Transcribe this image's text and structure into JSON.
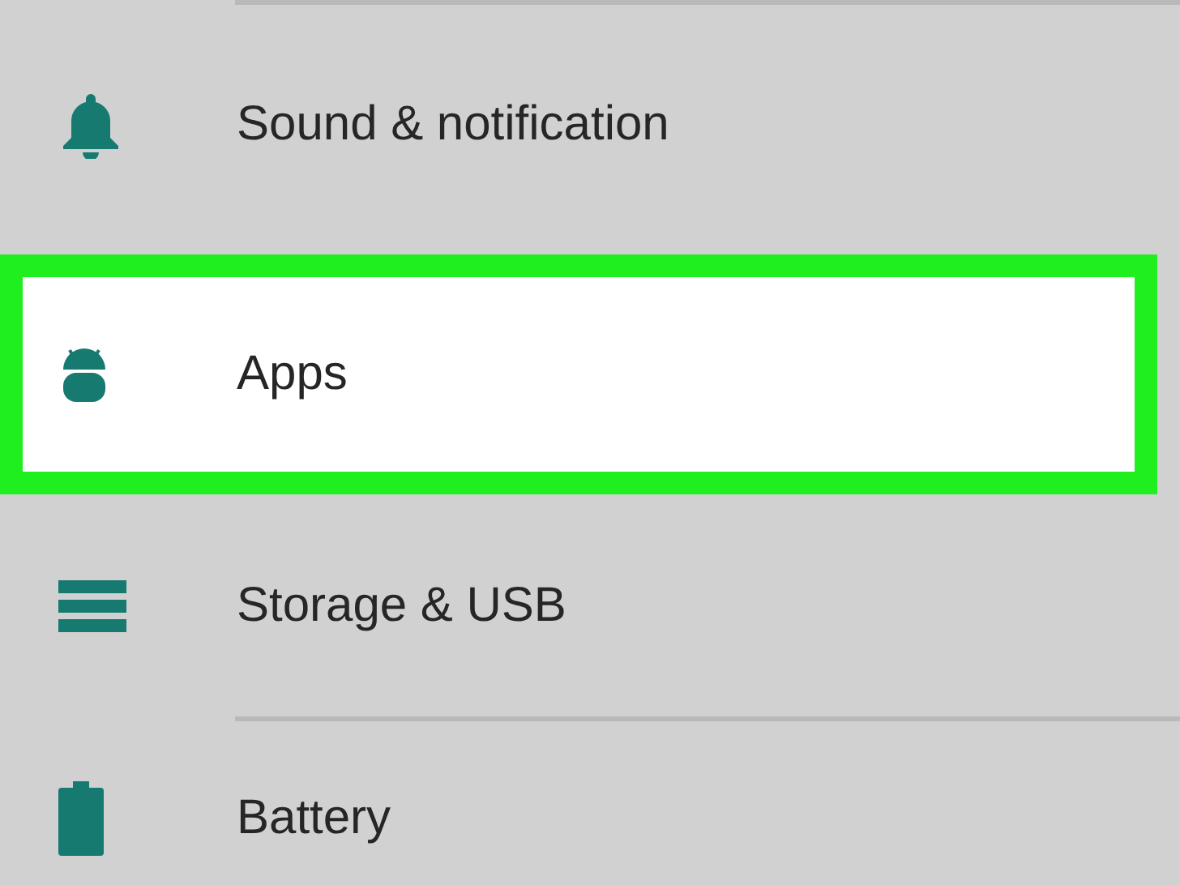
{
  "settings_items": [
    {
      "kind": "bell",
      "label": "Sound & notification",
      "selected": false
    },
    {
      "kind": "android",
      "label": "Apps",
      "selected": true
    },
    {
      "kind": "storage",
      "label": "Storage & USB",
      "selected": false
    },
    {
      "kind": "battery",
      "label": "Battery",
      "selected": false
    }
  ]
}
